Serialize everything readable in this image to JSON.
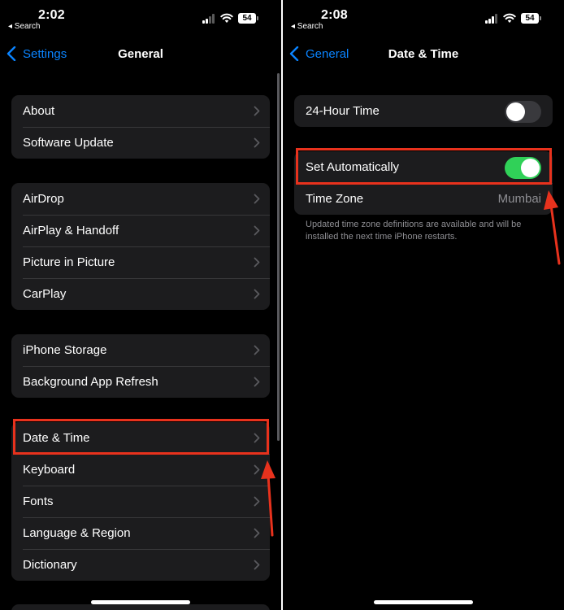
{
  "colors": {
    "background": "#000000",
    "cell": "#1c1c1e",
    "separator": "#38383a",
    "accent": "#0a84ff",
    "toggle_on": "#30d158",
    "toggle_off": "#39393d",
    "secondary_text": "#8e8e93",
    "annotation": "#e8321d"
  },
  "left_screen": {
    "status": {
      "time": "2:02",
      "back_app": "◂ Search",
      "battery": "54"
    },
    "nav": {
      "back_label": "Settings",
      "title": "General"
    },
    "groups": [
      {
        "rows": [
          {
            "label": "About"
          },
          {
            "label": "Software Update"
          }
        ]
      },
      {
        "rows": [
          {
            "label": "AirDrop"
          },
          {
            "label": "AirPlay & Handoff"
          },
          {
            "label": "Picture in Picture"
          },
          {
            "label": "CarPlay"
          }
        ]
      },
      {
        "rows": [
          {
            "label": "iPhone Storage"
          },
          {
            "label": "Background App Refresh"
          }
        ]
      },
      {
        "rows": [
          {
            "label": "Date & Time"
          },
          {
            "label": "Keyboard"
          },
          {
            "label": "Fonts"
          },
          {
            "label": "Language & Region"
          },
          {
            "label": "Dictionary"
          }
        ]
      }
    ],
    "highlighted_row": "Date & Time"
  },
  "right_screen": {
    "status": {
      "time": "2:08",
      "back_app": "◂ Search",
      "battery": "54"
    },
    "nav": {
      "back_label": "General",
      "title": "Date & Time"
    },
    "groups": [
      {
        "rows": [
          {
            "label": "24-Hour Time",
            "toggle": "off"
          }
        ]
      },
      {
        "rows": [
          {
            "label": "Set Automatically",
            "toggle": "on"
          },
          {
            "label": "Time Zone",
            "value": "Mumbai"
          }
        ]
      }
    ],
    "footnote": "Updated time zone definitions are available and will be installed the next time iPhone restarts.",
    "highlighted_row": "Set Automatically"
  }
}
